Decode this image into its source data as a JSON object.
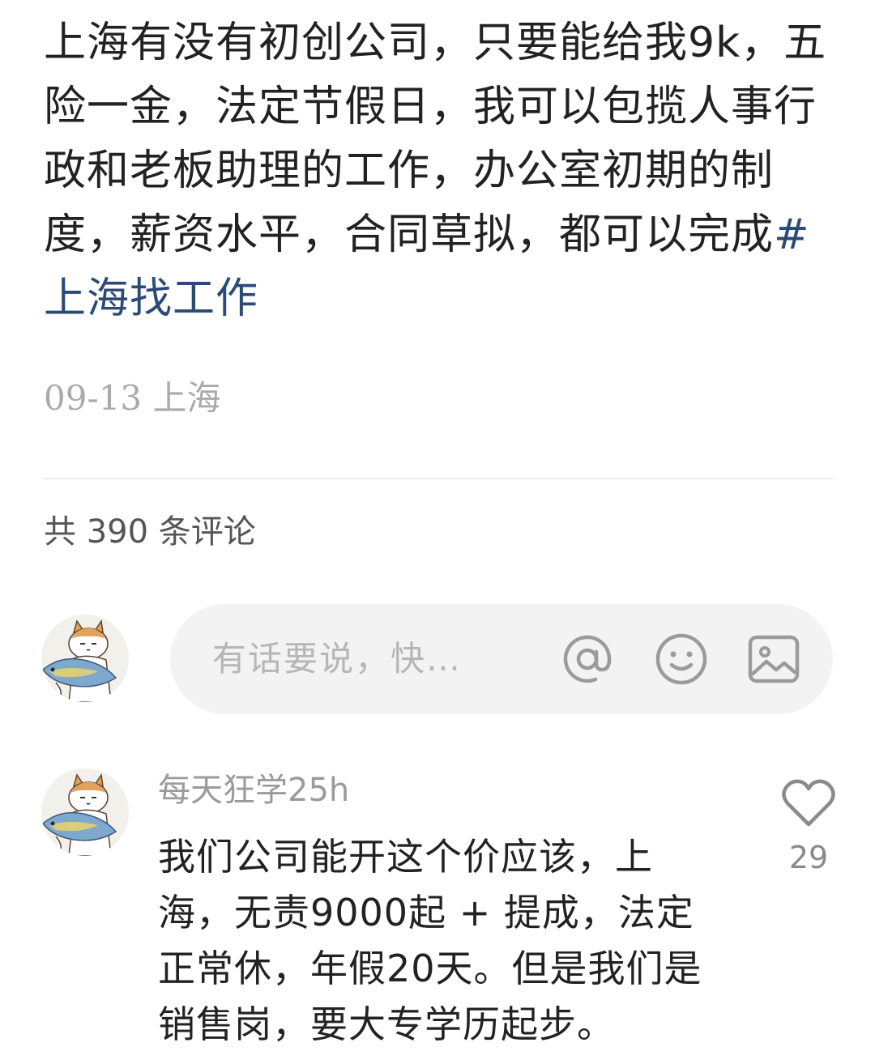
{
  "post": {
    "text": "上海有没有初创公司，只要能给我9k，五险一金，法定节假日，我可以包揽人事行政和老板助理的工作，办公室初期的制度，薪资水平，合同草拟，都可以完成",
    "hashtag": "#上海找工作",
    "date": "09-13",
    "location": "上海"
  },
  "comments_header": {
    "label": "共 390 条评论"
  },
  "compose": {
    "placeholder": "有话要说，快…",
    "icons": [
      "at-icon",
      "emoji-icon",
      "image-icon"
    ]
  },
  "comments": [
    {
      "author": "每天狂学",
      "time": "25h",
      "text": "我们公司能开这个价应该，上海，无责9000起 + 提成，法定正常休，年假20天。但是我们是销售岗，要大专学历起步。",
      "likes": "29"
    }
  ],
  "colors": {
    "text": "#222222",
    "hashtag": "#2b4a78",
    "meta": "#aaaaaa",
    "compose_bg": "#f3f3f3",
    "icon": "#9b9b9b"
  }
}
